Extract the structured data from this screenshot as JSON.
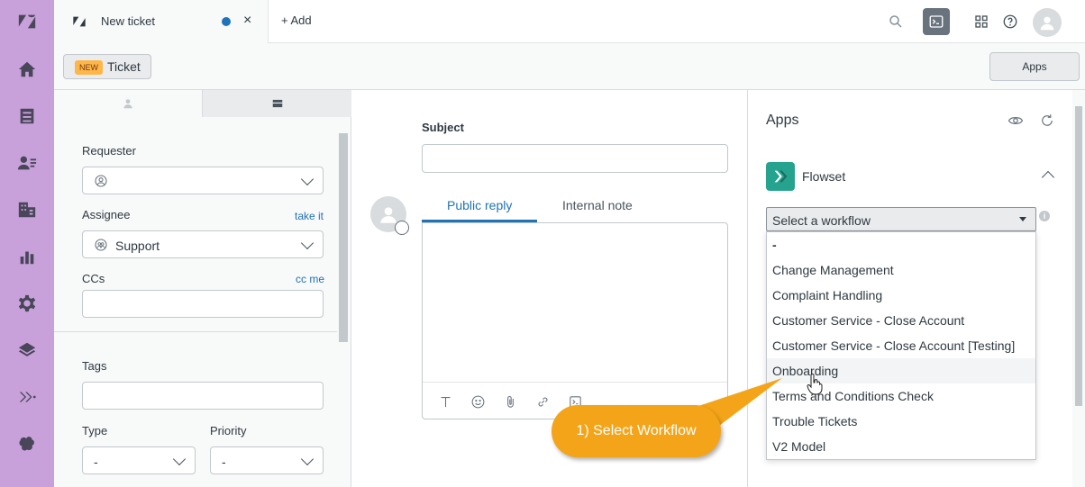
{
  "topbar": {
    "tab_title": "New ticket",
    "tab_close": "×",
    "add_label": "+ Add"
  },
  "subbar": {
    "badge": "NEW",
    "ticket_label": "Ticket",
    "apps_button": "Apps"
  },
  "properties": {
    "requester_label": "Requester",
    "assignee_label": "Assignee",
    "take_it_link": "take it",
    "assignee_value": "Support",
    "ccs_label": "CCs",
    "cc_me_link": "cc me",
    "tags_label": "Tags",
    "type_label": "Type",
    "type_value": "-",
    "priority_label": "Priority",
    "priority_value": "-"
  },
  "conversation": {
    "subject_label": "Subject",
    "tab_public_reply": "Public reply",
    "tab_internal_note": "Internal note"
  },
  "callout": {
    "text": "1) Select Workflow",
    "color": "#f4a418"
  },
  "apps_panel": {
    "title": "Apps",
    "app_name": "Flowset",
    "select_label": "Select a workflow",
    "info": "i",
    "workflow_options": [
      "-",
      "Change Management",
      "Complaint Handling",
      "Customer Service - Close Account",
      "Customer Service - Close Account [Testing]",
      "Onboarding",
      "Terms and Conditions Check",
      "Trouble Tickets",
      "V2 Model"
    ],
    "hovered_option": "Onboarding"
  },
  "colors": {
    "rail": "#c8a1db",
    "accent_blue": "#1f73b7",
    "flowset_green": "#25a38f",
    "new_badge": "#ffb648"
  }
}
